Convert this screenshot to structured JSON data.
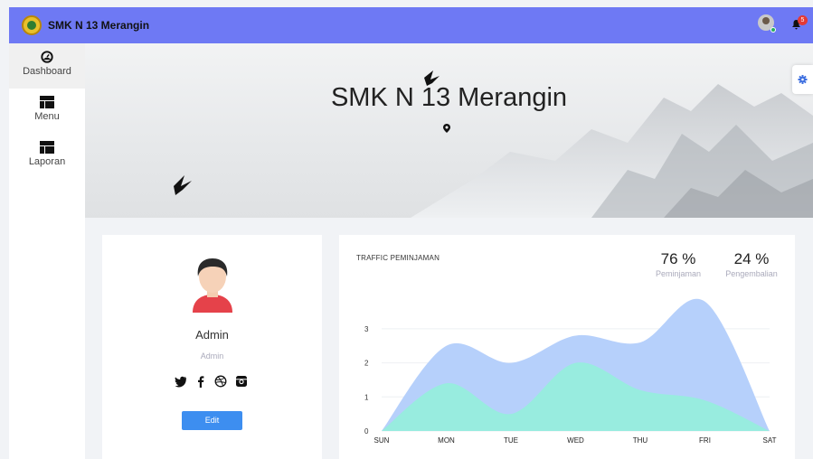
{
  "app": {
    "brand": "SMK N 13 Merangin"
  },
  "header": {
    "notification_count": "5",
    "bell_icon": "bell-icon",
    "avatar_icon": "user-avatar"
  },
  "sidebar": {
    "items": [
      {
        "label": "Dashboard",
        "icon": "dashboard-icon",
        "active": true
      },
      {
        "label": "Menu",
        "icon": "table-icon",
        "active": false
      },
      {
        "label": "Laporan",
        "icon": "table-icon",
        "active": false
      }
    ]
  },
  "hero": {
    "title": "SMK N 13 Merangin",
    "location_icon": "map-pin-icon"
  },
  "settings": {
    "icon": "gear-icon"
  },
  "profile": {
    "name": "Admin",
    "role": "Admin",
    "socials": [
      "twitter-icon",
      "facebook-icon",
      "dribbble-icon",
      "instagram-icon"
    ],
    "edit_label": "Edit"
  },
  "traffic": {
    "title": "TRAFFIC PEMINJAMAN",
    "stats": [
      {
        "value": "76 %",
        "label": "Peminjaman"
      },
      {
        "value": "24 %",
        "label": "Pengembalian"
      }
    ]
  },
  "chart_data": {
    "type": "area",
    "x": [
      "SUN",
      "MON",
      "TUE",
      "WED",
      "THU",
      "FRI",
      "SAT"
    ],
    "ylim": [
      0,
      3.9
    ],
    "yticks": [
      0,
      1,
      2,
      3
    ],
    "series": [
      {
        "values": [
          0,
          2.5,
          2.0,
          2.8,
          2.6,
          3.8,
          0
        ],
        "color": "#b6d0fb"
      },
      {
        "values": [
          0,
          1.4,
          0.5,
          2.0,
          1.2,
          0.9,
          0
        ],
        "color": "#98ecdf"
      }
    ]
  },
  "colors": {
    "topbar": "#6e79f4",
    "edit_button": "#3d8ef0"
  }
}
